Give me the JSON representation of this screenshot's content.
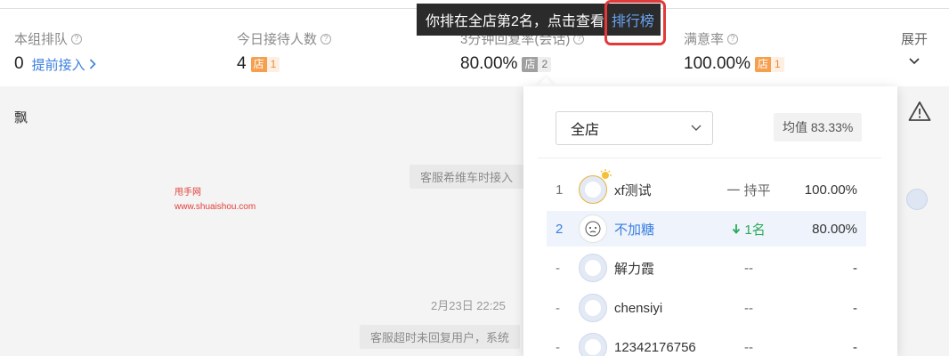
{
  "stats": [
    {
      "label": "本组排队",
      "value": "0",
      "link": "提前接入"
    },
    {
      "label": "今日接待人数",
      "value": "4",
      "badge": "店",
      "badge_num": "1"
    },
    {
      "label": "3分钟回复率(会话)",
      "value": "80.00%",
      "badge": "店",
      "badge_num": "2"
    },
    {
      "label": "满意率",
      "value": "100.00%",
      "badge": "店",
      "badge_num": "1"
    }
  ],
  "expand_label": "展开",
  "tooltip": {
    "text": "你排在全店第2名，点击查看",
    "link": "排行榜"
  },
  "chat": {
    "user_name": "飘",
    "system_msg_1": "客服希维车时接入",
    "watermark_line1": "甩手网",
    "watermark_line2": "www.shuaishou.com",
    "date": "2月23日 22:25",
    "system_msg_2": "客服超时未回复用户，系统"
  },
  "ranking": {
    "scope": "全店",
    "avg_label": "均值 83.33%",
    "rows": [
      {
        "index": "1",
        "name": "xf测试",
        "trend": "一 持平",
        "trend_type": "flat",
        "rate": "100.00%"
      },
      {
        "index": "2",
        "name": "不加糖",
        "trend": "1名",
        "trend_type": "up",
        "rate": "80.00%"
      },
      {
        "index": "-",
        "name": "解力霞",
        "trend": "--",
        "trend_type": "none",
        "rate": "-"
      },
      {
        "index": "-",
        "name": "chensiyi",
        "trend": "--",
        "trend_type": "none",
        "rate": "-"
      },
      {
        "index": "-",
        "name": "12342176756",
        "trend": "--",
        "trend_type": "none",
        "rate": "-"
      }
    ]
  },
  "colors": {
    "accent": "#3b7fe0",
    "badge": "#f5a04f",
    "up": "#2bab58",
    "highlight": "#e2393a"
  }
}
